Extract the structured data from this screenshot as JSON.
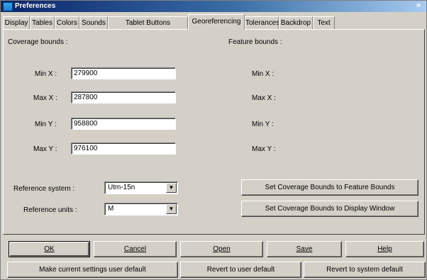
{
  "window": {
    "title": "Preferences",
    "close_glyph": "×"
  },
  "tabs": [
    {
      "label": "Display"
    },
    {
      "label": "Tables"
    },
    {
      "label": "Colors"
    },
    {
      "label": "Sounds"
    },
    {
      "label": "Tablet Buttons"
    },
    {
      "label": "Georeferencing"
    },
    {
      "label": "Tolerances"
    },
    {
      "label": "Backdrop"
    },
    {
      "label": "Text"
    }
  ],
  "active_tab": "Georeferencing",
  "coverage": {
    "heading": "Coverage bounds :",
    "min_x": {
      "label": "Min X :",
      "value": "279900"
    },
    "max_x": {
      "label": "Max X :",
      "value": "287800"
    },
    "min_y": {
      "label": "Min Y :",
      "value": "958800"
    },
    "max_y": {
      "label": "Max Y :",
      "value": "976100"
    }
  },
  "feature": {
    "heading": "Feature bounds :",
    "min_x": "Min X :",
    "max_x": "Max X :",
    "min_y": "Min Y :",
    "max_y": "Max Y :"
  },
  "reference": {
    "system_label": "Reference system :",
    "system_value": "Utm-15n",
    "units_label": "Reference units :",
    "units_value": "M"
  },
  "buttons": {
    "set_feature": "Set Coverage Bounds to Feature Bounds",
    "set_display": "Set Coverage Bounds to Display Window",
    "ok": "OK",
    "cancel": "Cancel",
    "open": "Open",
    "save": "Save",
    "help": "Help",
    "make_default": "Make current settings user default",
    "revert_user": "Revert to user default",
    "revert_system": "Revert to system default"
  },
  "colors": {
    "title_start": "#0a246a",
    "face": "#d4d0c8"
  }
}
